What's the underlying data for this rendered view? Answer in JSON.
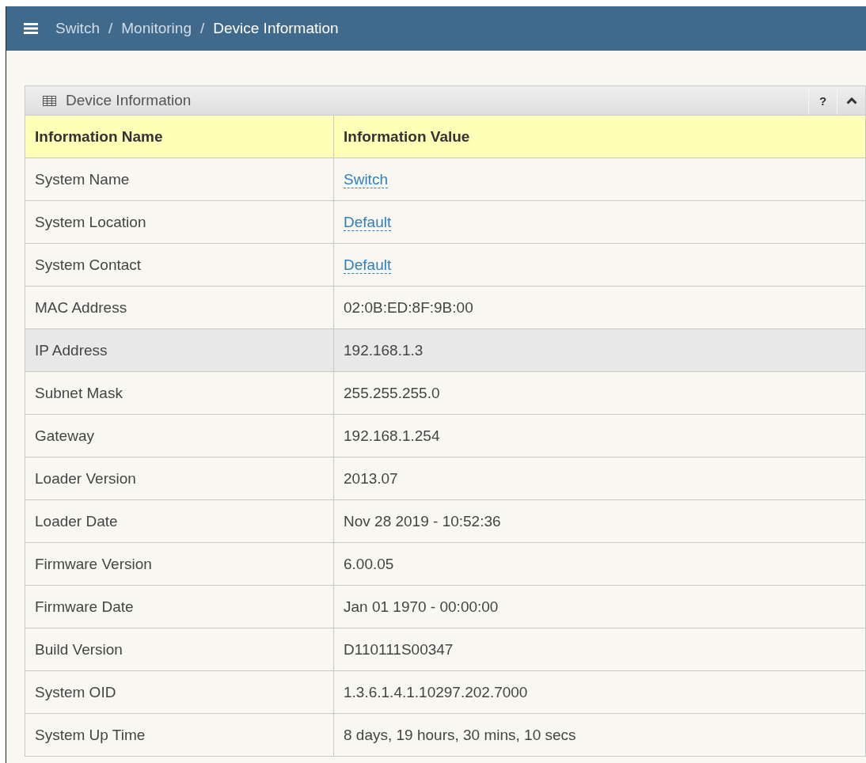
{
  "breadcrumb": [
    "Switch",
    "Monitoring",
    "Device Information"
  ],
  "breadcrumb_separators": [
    "/",
    "/"
  ],
  "panel": {
    "title": "Device Information",
    "help": "?",
    "columns": [
      "Information Name",
      "Information Value"
    ],
    "rows": [
      {
        "name": "System Name",
        "value": "Switch",
        "kind": "link",
        "highlighted": false
      },
      {
        "name": "System Location",
        "value": "Default",
        "kind": "link",
        "highlighted": false
      },
      {
        "name": "System Contact",
        "value": "Default",
        "kind": "link",
        "highlighted": false
      },
      {
        "name": "MAC Address",
        "value": "02:0B:ED:8F:9B:00",
        "kind": "text",
        "highlighted": false
      },
      {
        "name": "IP Address",
        "value": "192.168.1.3",
        "kind": "text",
        "highlighted": true
      },
      {
        "name": "Subnet Mask",
        "value": "255.255.255.0",
        "kind": "text",
        "highlighted": false
      },
      {
        "name": "Gateway",
        "value": "192.168.1.254",
        "kind": "text",
        "highlighted": false
      },
      {
        "name": "Loader Version",
        "value": "2013.07",
        "kind": "text",
        "highlighted": false
      },
      {
        "name": "Loader Date",
        "value": "Nov 28 2019 - 10:52:36",
        "kind": "text",
        "highlighted": false
      },
      {
        "name": "Firmware Version",
        "value": "6.00.05",
        "kind": "text",
        "highlighted": false
      },
      {
        "name": "Firmware Date",
        "value": "Jan 01 1970 - 00:00:00",
        "kind": "text",
        "highlighted": false
      },
      {
        "name": "Build Version",
        "value": "D110111S00347",
        "kind": "text",
        "highlighted": false
      },
      {
        "name": "System OID",
        "value": "1.3.6.1.4.1.10297.202.7000",
        "kind": "text",
        "highlighted": false
      },
      {
        "name": "System Up Time",
        "value": "8 days, 19 hours, 30 mins, 10 secs",
        "kind": "text",
        "highlighted": false
      }
    ]
  }
}
